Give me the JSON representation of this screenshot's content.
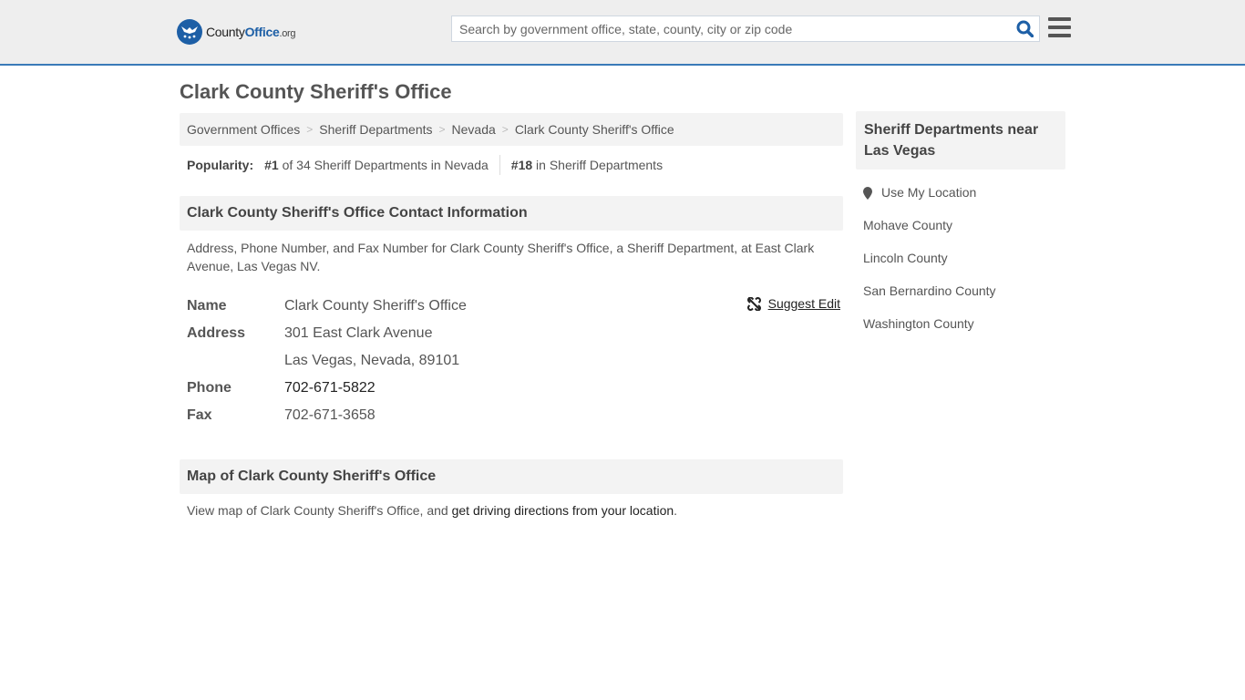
{
  "header": {
    "logo": {
      "prefix": "County",
      "brand": "Office",
      "suffix": ".org"
    },
    "search": {
      "placeholder": "Search by government office, state, county, city or zip code",
      "value": ""
    },
    "icons": {
      "search": "search-icon",
      "menu": "hamburger-menu-icon",
      "logo": "eagle-stars-icon"
    }
  },
  "page": {
    "title": "Clark County Sheriff's Office"
  },
  "breadcrumb": {
    "items": [
      "Government Offices",
      "Sheriff Departments",
      "Nevada",
      "Clark County Sheriff's Office"
    ],
    "separator": ">"
  },
  "popularity": {
    "label": "Popularity:",
    "state_rank": "#1",
    "state_text": "of 34 Sheriff Departments in Nevada",
    "national_rank": "#18",
    "national_text": "in Sheriff Departments"
  },
  "contact": {
    "heading": "Clark County Sheriff's Office Contact Information",
    "description": "Address, Phone Number, and Fax Number for Clark County Sheriff's Office, a Sheriff Department, at East Clark Avenue, Las Vegas NV.",
    "suggest_edit": "Suggest Edit",
    "rows": {
      "name": {
        "label": "Name",
        "value": "Clark County Sheriff's Office"
      },
      "address": {
        "label": "Address",
        "line1": "301 East Clark Avenue",
        "line2": "Las Vegas, Nevada, 89101"
      },
      "phone": {
        "label": "Phone",
        "value": "702-671-5822"
      },
      "fax": {
        "label": "Fax",
        "value": "702-671-3658"
      }
    }
  },
  "map": {
    "heading": "Map of Clark County Sheriff's Office",
    "text": "View map of Clark County Sheriff's Office, and ",
    "link": "get driving directions from your location",
    "end": "."
  },
  "sidebar": {
    "heading": "Sheriff Departments near Las Vegas",
    "use_location": "Use My Location",
    "items": [
      "Mohave County",
      "Lincoln County",
      "San Bernardino County",
      "Washington County"
    ]
  },
  "colors": {
    "brand_blue": "#1d5fa6",
    "header_border": "#3a7ab8",
    "panel_bg": "#f3f3f3"
  }
}
